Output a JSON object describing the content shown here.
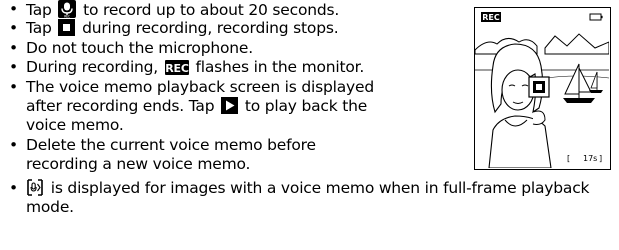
{
  "page": {
    "bullets": [
      {
        "pre": "Tap ",
        "post": " to record up to about 20 seconds.",
        "icon": "record-mic-icon"
      },
      {
        "pre": "Tap ",
        "post": " during recording, recording stops.",
        "icon": "stop-square-icon"
      },
      {
        "text": "Do not touch the microphone."
      },
      {
        "pre": "During recording, ",
        "post": " flashes in the monitor.",
        "icon": "rec-badge-icon"
      },
      {
        "line1": "The voice memo playback screen is displayed",
        "pre2": "after recording ends. Tap ",
        "post2": " to play back the",
        "line3": "voice memo.",
        "icon": "play-triangle-icon"
      },
      {
        "line1": "Delete the current voice memo before",
        "line2": "recording a new voice memo."
      },
      {
        "line1": " is displayed for images with a voice memo when in full-frame playback",
        "line2": "mode.",
        "icon": "voice-memo-indicator-icon"
      }
    ],
    "bullet_symbol": "•"
  },
  "monitor": {
    "rec_label": "REC",
    "remaining_time": "17s",
    "icons": [
      "battery-icon",
      "stop-button-icon",
      "sailboat-icon",
      "mountains-icon",
      "person-icon"
    ]
  }
}
